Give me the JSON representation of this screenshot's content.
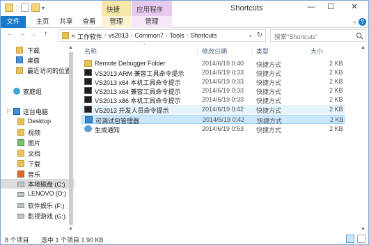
{
  "window": {
    "title": "Shortcuts",
    "controls": {
      "minimize": "—",
      "maximize": "☐",
      "close": "✕"
    }
  },
  "context_tabs": {
    "shortcut_tools": "快捷工具",
    "app_tools": "应用程序工具"
  },
  "ribbon": {
    "file": "文件",
    "home": "主页",
    "share": "共享",
    "view": "查看",
    "manage1": "管理",
    "manage2": "管理",
    "toggle": "⌄",
    "help": "?"
  },
  "nav": {
    "back": "←",
    "forward": "→",
    "recent": "⌄",
    "up": "↑",
    "breadcrumb": [
      "«",
      "工作软件",
      "vs2013",
      "Common7",
      "Tools",
      "Shortcuts"
    ],
    "separator": "›",
    "dropdown": "⌄",
    "refresh": "↻",
    "search_placeholder": "搜索\"Shortcuts\""
  },
  "sidebar": {
    "items": [
      {
        "label": "下载",
        "icon": "download-folder-icon"
      },
      {
        "label": "桌面",
        "icon": "desktop-icon"
      },
      {
        "label": "最近访问的位置",
        "icon": "recent-places-icon"
      },
      {
        "label": "家庭组",
        "icon": "homegroup-icon"
      },
      {
        "label": "这台电脑",
        "icon": "this-pc-icon"
      },
      {
        "label": "Desktop",
        "icon": "folder-icon"
      },
      {
        "label": "视频",
        "icon": "videos-icon"
      },
      {
        "label": "图片",
        "icon": "pictures-icon"
      },
      {
        "label": "文档",
        "icon": "documents-icon"
      },
      {
        "label": "下载",
        "icon": "downloads-icon"
      },
      {
        "label": "音乐",
        "icon": "music-icon"
      },
      {
        "label": "本地磁盘 (C:)",
        "icon": "drive-icon"
      },
      {
        "label": "LENOVO (D:)",
        "icon": "drive-icon"
      },
      {
        "label": "软件娱乐 (F:)",
        "icon": "drive-icon"
      },
      {
        "label": "影视游戏 (G:)",
        "icon": "drive-icon"
      }
    ],
    "expander": "▷"
  },
  "columns": {
    "name": "名称",
    "date": "修改日期",
    "type": "类型",
    "size": "大小",
    "sort_indicator": "^"
  },
  "files": [
    {
      "name": "Remote Debugger Folder",
      "date": "2014/6/19 0:40",
      "type": "快捷方式",
      "size": "2 KB",
      "icon": "folder-shortcut-icon"
    },
    {
      "name": "VS2013 ARM 兼容工具命令提示",
      "date": "2014/6/19 0:33",
      "type": "快捷方式",
      "size": "2 KB",
      "icon": "cmd-icon"
    },
    {
      "name": "VS2013 x64 本机工具命令提示",
      "date": "2014/6/19 0:33",
      "type": "快捷方式",
      "size": "2 KB",
      "icon": "cmd-icon"
    },
    {
      "name": "VS2013 x64 兼容工具命令提示",
      "date": "2014/6/19 0:33",
      "type": "快捷方式",
      "size": "2 KB",
      "icon": "cmd-icon"
    },
    {
      "name": "VS2013 x86 本机工具命令提示",
      "date": "2014/6/19 0:33",
      "type": "快捷方式",
      "size": "2 KB",
      "icon": "cmd-icon"
    },
    {
      "name": "VS2013 开发人员命令提示",
      "date": "2014/6/19 0:42",
      "type": "快捷方式",
      "size": "2 KB",
      "icon": "cmd-icon"
    },
    {
      "name": "可调试包管理器",
      "date": "2014/6/19 0:42",
      "type": "快捷方式",
      "size": "2 KB",
      "icon": "package-manager-icon"
    },
    {
      "name": "生成通知",
      "date": "2014/6/19 0:53",
      "type": "快捷方式",
      "size": "2 KB",
      "icon": "notification-icon"
    }
  ],
  "status": {
    "count": "8 个项目",
    "selection": "选中 1 个项目  1.90 KB"
  },
  "scroll": {
    "up": "▲",
    "down": "▼"
  },
  "colors": {
    "file_tab": "#1979ca",
    "shortcut_tools": "#f6e6a8",
    "app_tools": "#e8c9ef",
    "selection": "#cce8ff",
    "hover": "#e5f3fb"
  }
}
